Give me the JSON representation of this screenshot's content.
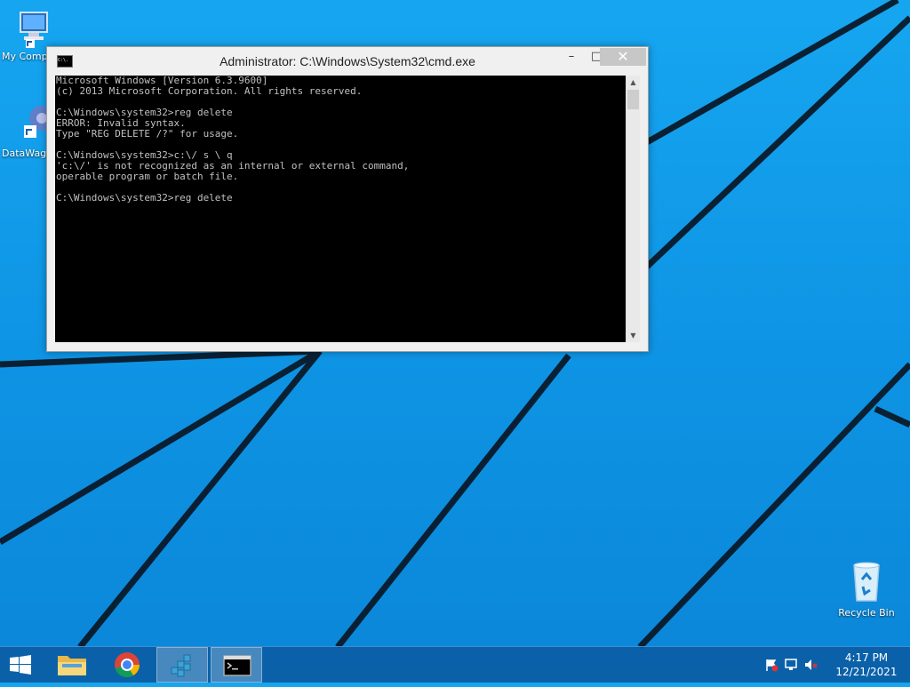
{
  "desktop": {
    "icons": [
      {
        "name": "my-computer",
        "label": "My Comp"
      },
      {
        "name": "datawag",
        "label": "DataWag"
      },
      {
        "name": "recycle-bin",
        "label": "Recycle Bin"
      }
    ]
  },
  "window": {
    "title": "Administrator: C:\\Windows\\System32\\cmd.exe",
    "icon_text": "C:\\.",
    "minimize": "–",
    "maximize": "□",
    "close": "✕"
  },
  "console": {
    "lines": [
      "Microsoft Windows [Version 6.3.9600]",
      "(c) 2013 Microsoft Corporation. All rights reserved.",
      "",
      "C:\\Windows\\system32>reg delete",
      "ERROR: Invalid syntax.",
      "Type \"REG DELETE /?\" for usage.",
      "",
      "C:\\Windows\\system32>c:\\/ s \\ q",
      "'c:\\/' is not recognized as an internal or external command,",
      "operable program or batch file.",
      "",
      "C:\\Windows\\system32>reg delete"
    ]
  },
  "taskbar": {
    "buttons": [
      {
        "name": "start",
        "icon": "windows-logo-icon"
      },
      {
        "name": "file-explorer",
        "icon": "folder-icon"
      },
      {
        "name": "chrome",
        "icon": "chrome-icon"
      },
      {
        "name": "regedit",
        "icon": "registry-editor-icon",
        "active": true
      },
      {
        "name": "cmd",
        "icon": "command-prompt-icon",
        "active": true
      }
    ],
    "clock": {
      "time": "4:17 PM",
      "date": "12/21/2021"
    },
    "tray_icons": [
      "action-center-flag-icon",
      "network-icon",
      "volume-muted-icon"
    ]
  },
  "colors": {
    "desktop": "#0f96e6",
    "taskbar": "#0a5aa0",
    "console_bg": "#000000",
    "console_fg": "#c0c0c0"
  }
}
